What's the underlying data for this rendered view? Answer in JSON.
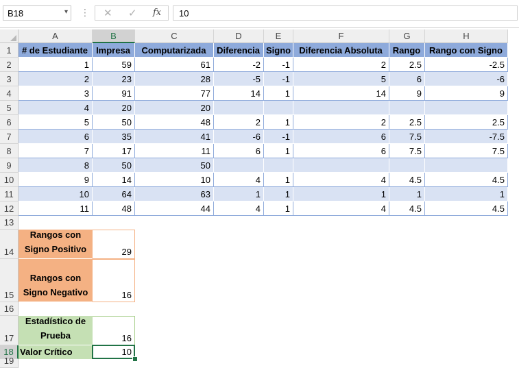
{
  "formula_bar": {
    "name_box": "B18",
    "name_box_arrow": "▾",
    "dots": "⋮",
    "cancel_icon": "✕",
    "enter_icon": "✓",
    "fx_label": "fx",
    "formula": "10"
  },
  "columns": [
    "A",
    "B",
    "C",
    "D",
    "E",
    "F",
    "G",
    "H"
  ],
  "rows": [
    "1",
    "2",
    "3",
    "4",
    "5",
    "6",
    "7",
    "8",
    "9",
    "10",
    "11",
    "12",
    "13",
    "14",
    "15",
    "16",
    "17",
    "18",
    "19"
  ],
  "table": {
    "headers": [
      "# de Estudiante",
      "Impresa",
      "Computarizada",
      "Diferencia",
      "Signo",
      "Diferencia Absoluta",
      "Rango",
      "Rango con Signo"
    ],
    "rows": [
      [
        "1",
        "59",
        "61",
        "-2",
        "-1",
        "2",
        "2.5",
        "-2.5"
      ],
      [
        "2",
        "23",
        "28",
        "-5",
        "-1",
        "5",
        "6",
        "-6"
      ],
      [
        "3",
        "91",
        "77",
        "14",
        "1",
        "14",
        "9",
        "9"
      ],
      [
        "4",
        "20",
        "20",
        "",
        "",
        "",
        "",
        ""
      ],
      [
        "5",
        "50",
        "48",
        "2",
        "1",
        "2",
        "2.5",
        "2.5"
      ],
      [
        "6",
        "35",
        "41",
        "-6",
        "-1",
        "6",
        "7.5",
        "-7.5"
      ],
      [
        "7",
        "17",
        "11",
        "6",
        "1",
        "6",
        "7.5",
        "7.5"
      ],
      [
        "8",
        "50",
        "50",
        "",
        "",
        "",
        "",
        ""
      ],
      [
        "9",
        "14",
        "10",
        "4",
        "1",
        "4",
        "4.5",
        "4.5"
      ],
      [
        "10",
        "64",
        "63",
        "1",
        "1",
        "1",
        "1",
        "1"
      ],
      [
        "11",
        "48",
        "44",
        "4",
        "1",
        "4",
        "4.5",
        "4.5"
      ]
    ]
  },
  "summary": {
    "pos_label_1": "Rangos con",
    "pos_label_2": "Signo Positivo",
    "pos_value": "29",
    "neg_label_1": "Rangos con",
    "neg_label_2": "Signo Negativo",
    "neg_value": "16",
    "stat_label_1": "Estadístico de",
    "stat_label_2": "Prueba",
    "stat_value": "16",
    "crit_label": "Valor Crítico",
    "crit_value": "10"
  },
  "colors": {
    "header_fill": "#8eaadb",
    "band_fill": "#d9e2f3",
    "orange_fill": "#f4b183",
    "green_fill": "#c5e0b4",
    "selection": "#217346"
  }
}
